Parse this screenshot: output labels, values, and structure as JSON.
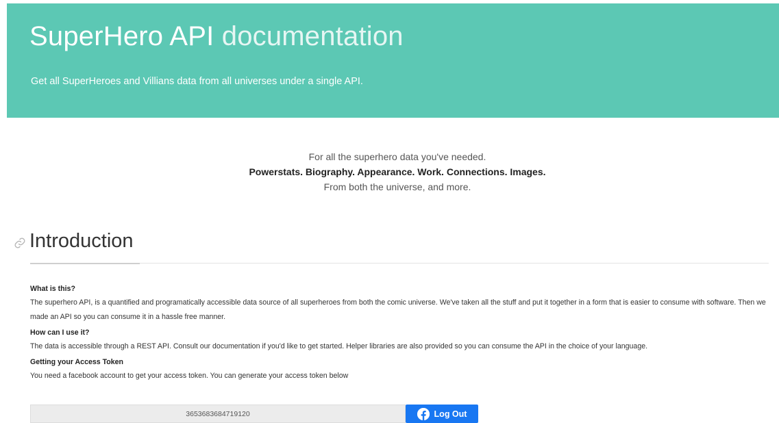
{
  "hero": {
    "title_main": "SuperHero API",
    "title_light": "documentation",
    "tagline": "Get all SuperHeroes and Villians data from all universes under a single API."
  },
  "lead": {
    "line1": "For all the superhero data you've needed.",
    "line2": "Powerstats. Biography. Appearance. Work. Connections. Images.",
    "line3": "From both the universe, and more."
  },
  "introduction": {
    "title": "Introduction",
    "icon": "link-icon",
    "sections": [
      {
        "heading": "What is this?",
        "body": "The superhero API, is a quantified and programatically accessible data source of all superheroes from both the comic universe. We've taken all the stuff and put it together in a form that is easier to consume with software. Then we made an API so you can consume it in a hassle free manner."
      },
      {
        "heading": "How can I use it?",
        "body": "The data is accessible through a REST API. Consult our documentation if you'd like to get started. Helper libraries are also provided so you can consume the API in the choice of your language."
      },
      {
        "heading": "Getting your Access Token",
        "body": "You need a facebook account to get your access token. You can generate your access token below"
      }
    ]
  },
  "token": {
    "value": "3653683684719120",
    "button_label": "Log Out",
    "button_icon": "facebook-icon"
  },
  "colors": {
    "hero_bg": "#5cc8b4",
    "facebook_blue": "#1877f2"
  }
}
